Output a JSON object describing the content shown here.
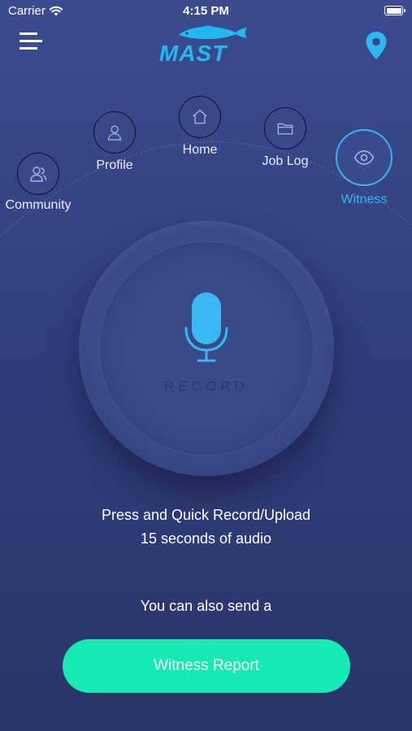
{
  "status_bar": {
    "carrier": "Carrier",
    "time": "4:15 PM"
  },
  "header": {
    "logo_text": "MAST",
    "menu_icon": "hamburger-menu-icon",
    "location_icon": "map-pin-icon"
  },
  "nav": {
    "items": [
      {
        "label": "Community",
        "icon": "users-icon"
      },
      {
        "label": "Profile",
        "icon": "user-icon"
      },
      {
        "label": "Home",
        "icon": "home-icon"
      },
      {
        "label": "Job Log",
        "icon": "folder-icon"
      },
      {
        "label": "Witness",
        "icon": "eye-icon",
        "active": true
      }
    ]
  },
  "record": {
    "label": "RECORD",
    "icon": "microphone-icon"
  },
  "instructions": {
    "line1": "Press and Quick Record/Upload",
    "line2": "15 seconds of audio",
    "line3": "You can also send a"
  },
  "witness_button": {
    "label": "Witness Report"
  },
  "colors": {
    "accent": "#34b6f2",
    "button": "#15eab2",
    "background": "#323f7e"
  }
}
